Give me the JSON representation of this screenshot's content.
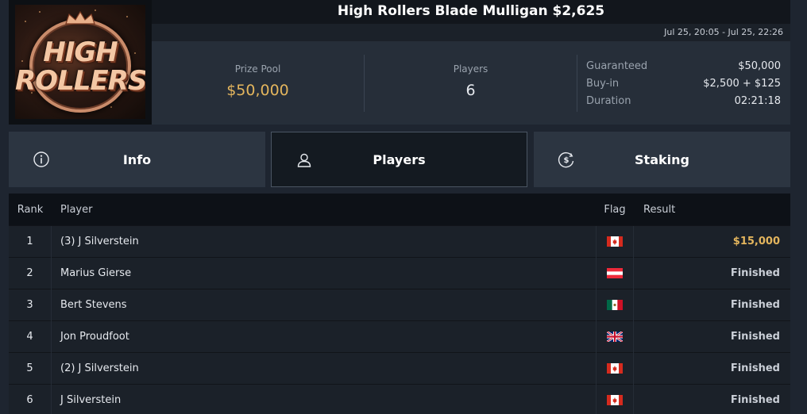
{
  "tournament": {
    "title": "High Rollers Blade Mulligan $2,625",
    "date_range": "Jul 25, 20:05 - Jul 25, 22:26",
    "logo_text": [
      "HIGH",
      "ROLLERS"
    ]
  },
  "stats": {
    "prize_pool_label": "Prize Pool",
    "prize_pool_value": "$50,000",
    "players_label": "Players",
    "players_value": "6",
    "details": [
      {
        "label": "Guaranteed",
        "value": "$50,000"
      },
      {
        "label": "Buy-in",
        "value": "$2,500 + $125"
      },
      {
        "label": "Duration",
        "value": "02:21:18"
      }
    ]
  },
  "tabs": [
    {
      "label": "Info",
      "icon": "info-icon",
      "active": false
    },
    {
      "label": "Players",
      "icon": "user-icon",
      "active": true
    },
    {
      "label": "Staking",
      "icon": "dollar-coin-icon",
      "active": false
    }
  ],
  "table": {
    "headers": {
      "rank": "Rank",
      "player": "Player",
      "flag": "Flag",
      "result": "Result"
    },
    "rows": [
      {
        "rank": "1",
        "player": "(3) J Silverstein",
        "flag": "canada",
        "result": "$15,000"
      },
      {
        "rank": "2",
        "player": "Marius Gierse",
        "flag": "austria",
        "result": "Finished"
      },
      {
        "rank": "3",
        "player": "Bert Stevens",
        "flag": "mexico",
        "result": "Finished"
      },
      {
        "rank": "4",
        "player": "Jon Proudfoot",
        "flag": "united-kingdom",
        "result": "Finished"
      },
      {
        "rank": "5",
        "player": "(2) J Silverstein",
        "flag": "canada",
        "result": "Finished"
      },
      {
        "rank": "6",
        "player": "J Silverstein",
        "flag": "canada",
        "result": "Finished"
      }
    ]
  },
  "colors": {
    "accent_gold": "#e3b55d",
    "background": "#1e2530"
  }
}
